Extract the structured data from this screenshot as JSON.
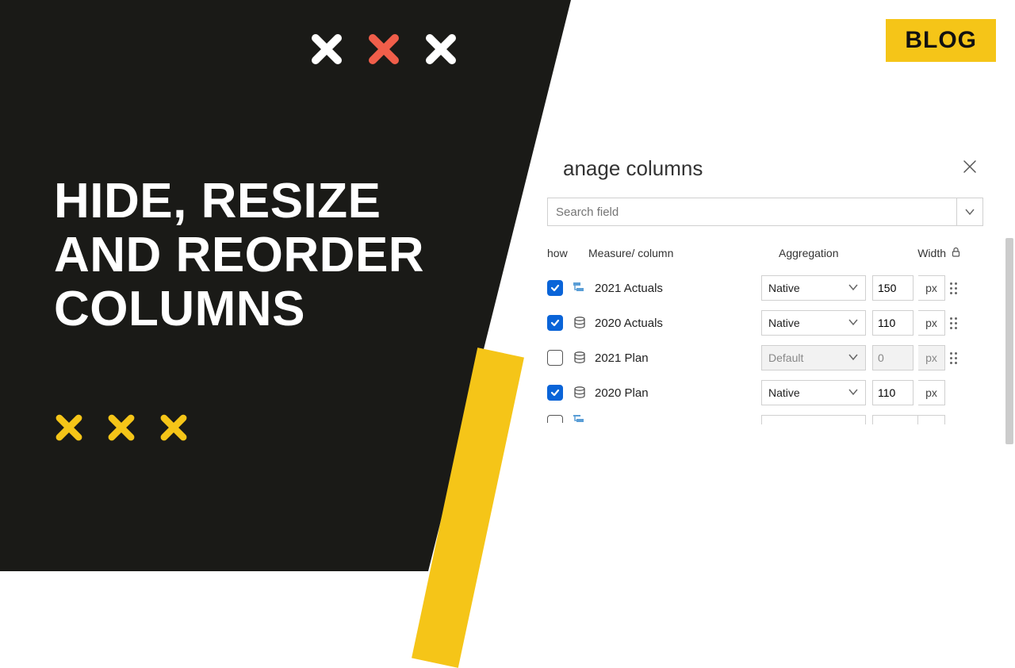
{
  "badge": {
    "label": "BLOG"
  },
  "title": {
    "line1": "HIDE, RESIZE",
    "line2": "AND REORDER",
    "line3": "COLUMNS"
  },
  "panel": {
    "title": "anage columns",
    "search_placeholder": "Search field",
    "headers": {
      "show": "how",
      "measure": "Measure/ column",
      "aggregation": "Aggregation",
      "width": "Width"
    },
    "px_label": "px",
    "rows": [
      {
        "checked": true,
        "icon": "hierarchy",
        "label": "2021 Actuals",
        "aggregation": "Native",
        "width": "150",
        "disabled": false
      },
      {
        "checked": true,
        "icon": "database",
        "label": "2020 Actuals",
        "aggregation": "Native",
        "width": "110",
        "disabled": false
      },
      {
        "checked": false,
        "icon": "database",
        "label": "2021 Plan",
        "aggregation": "Default",
        "width": "0",
        "disabled": true
      },
      {
        "checked": true,
        "icon": "database",
        "label": "2020 Plan",
        "aggregation": "Native",
        "width": "110",
        "disabled": false
      }
    ]
  },
  "colors": {
    "yellow": "#f5c518",
    "blue": "#4560f5",
    "coral": "#f05e4a",
    "dark": "#1a1a17"
  }
}
